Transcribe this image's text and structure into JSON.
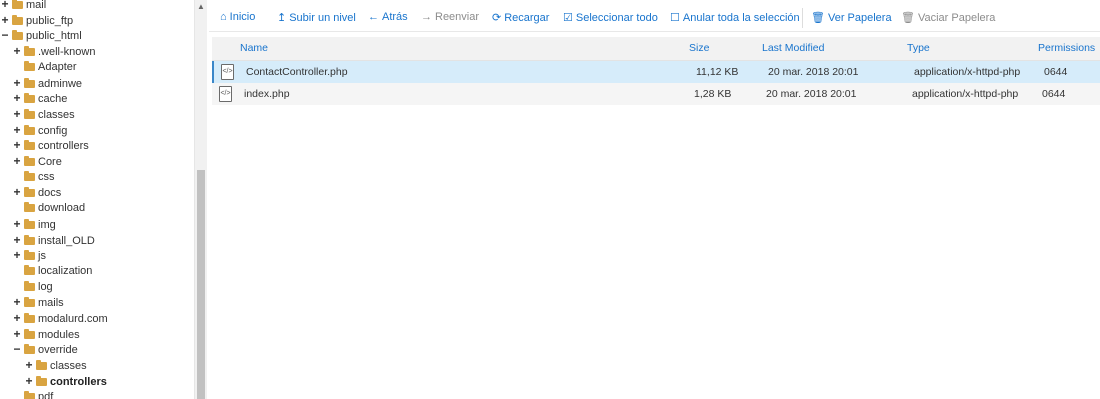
{
  "tree": {
    "items": [
      {
        "toggle": "+",
        "label": "mail",
        "bold": false
      },
      {
        "toggle": "+",
        "label": "public_ftp",
        "bold": false
      },
      {
        "toggle": "−",
        "label": "public_html",
        "bold": false
      },
      {
        "toggle": "+",
        "label": ".well-known",
        "bold": false
      },
      {
        "toggle": "",
        "label": "Adapter",
        "bold": false
      },
      {
        "toggle": "+",
        "label": "adminwe",
        "bold": false
      },
      {
        "toggle": "+",
        "label": "cache",
        "bold": false
      },
      {
        "toggle": "+",
        "label": "classes",
        "bold": false
      },
      {
        "toggle": "+",
        "label": "config",
        "bold": false
      },
      {
        "toggle": "+",
        "label": "controllers",
        "bold": false
      },
      {
        "toggle": "+",
        "label": "Core",
        "bold": false
      },
      {
        "toggle": "",
        "label": "css",
        "bold": false
      },
      {
        "toggle": "+",
        "label": "docs",
        "bold": false
      },
      {
        "toggle": "",
        "label": "download",
        "bold": false
      },
      {
        "toggle": "+",
        "label": "img",
        "bold": false
      },
      {
        "toggle": "+",
        "label": "install_OLD",
        "bold": false
      },
      {
        "toggle": "+",
        "label": "js",
        "bold": false
      },
      {
        "toggle": "",
        "label": "localization",
        "bold": false
      },
      {
        "toggle": "",
        "label": "log",
        "bold": false
      },
      {
        "toggle": "+",
        "label": "mails",
        "bold": false
      },
      {
        "toggle": "+",
        "label": "modalurd.com",
        "bold": false
      },
      {
        "toggle": "+",
        "label": "modules",
        "bold": false
      },
      {
        "toggle": "−",
        "label": "override",
        "bold": false
      },
      {
        "toggle": "+",
        "label": "classes",
        "bold": false
      },
      {
        "toggle": "+",
        "label": "controllers",
        "bold": true
      },
      {
        "toggle": "",
        "label": "pdf",
        "bold": false
      }
    ]
  },
  "scrollbar": {
    "up_arrow": "▲"
  },
  "toolbar": {
    "home": "Inicio",
    "up": "Subir un nivel",
    "back": "Atrás",
    "forward": "Reenviar",
    "reload": "Recargar",
    "select_all": "Seleccionar todo",
    "deselect_all": "Anular toda la selección",
    "view_trash": "Ver Papelera",
    "empty_trash": "Vaciar Papelera"
  },
  "table": {
    "headers": {
      "name": "Name",
      "size": "Size",
      "modified": "Last Modified",
      "type": "Type",
      "permissions": "Permissions"
    },
    "rows": [
      {
        "name": "ContactController.php",
        "size": "11,12 KB",
        "modified": "20 mar. 2018 20:01",
        "type": "application/x-httpd-php",
        "permissions": "0644",
        "icon": "</>",
        "selected": true
      },
      {
        "name": "index.php",
        "size": "1,28 KB",
        "modified": "20 mar. 2018 20:01",
        "type": "application/x-httpd-php",
        "permissions": "0644",
        "icon": "</>",
        "selected": false
      }
    ]
  },
  "colors": {
    "link": "#1874cd",
    "selected_row": "#d6ecfa",
    "folder": "#d9a441"
  }
}
